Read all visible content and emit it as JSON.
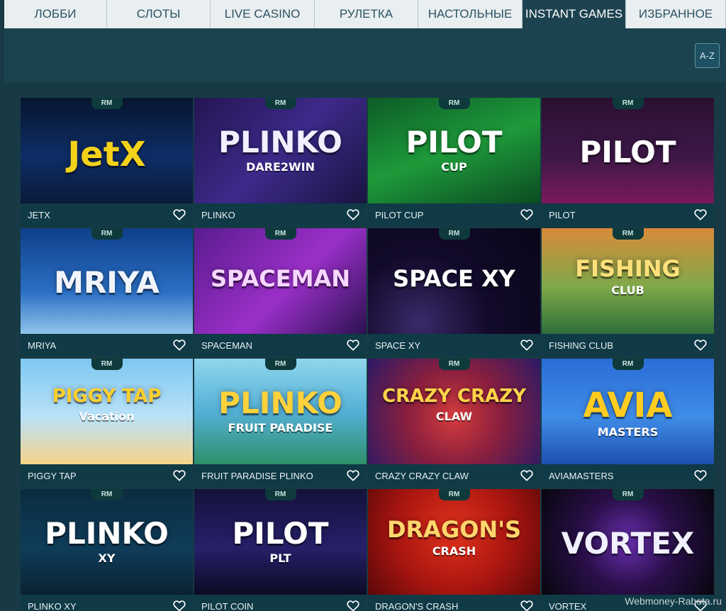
{
  "tabs": [
    {
      "label": "ЛОББИ",
      "width": 145,
      "active": false
    },
    {
      "label": "СЛОТЫ",
      "width": 146,
      "active": false
    },
    {
      "label": "LIVE CASINO",
      "width": 147,
      "active": false
    },
    {
      "label": "РУЛЕТКА",
      "width": 146,
      "active": false
    },
    {
      "label": "НАСТОЛЬНЫЕ",
      "width": 147,
      "active": false
    },
    {
      "label": "INSTANT GAMES",
      "width": 146,
      "active": true
    },
    {
      "label": "ИЗБРАННОЕ",
      "width": 141,
      "active": false
    }
  ],
  "sort_button": {
    "label": "A-Z"
  },
  "badge_label": "RM",
  "games": [
    {
      "title": "JETX",
      "art": "JetX",
      "bg": "linear-gradient(180deg,#07152f 0%,#0e2d66 55%,#0a1a3a 100%)",
      "art_color": "#f4d21a"
    },
    {
      "title": "PLINKO",
      "art": "PLINKO",
      "sub": "DARE2WIN",
      "bg": "linear-gradient(135deg,#241653 0%,#3d2a8a 50%,#1a1440 100%)",
      "art_color": "#f1f0ff"
    },
    {
      "title": "PILOT CUP",
      "art": "PILOT",
      "sub": "CUP",
      "bg": "linear-gradient(160deg,#0d5c27 0%,#1e9a3a 50%,#0b4a22 100%)",
      "art_color": "#ffffff"
    },
    {
      "title": "PILOT",
      "art": "PILOT",
      "bg": "linear-gradient(180deg,#2a1030 0%,#3d1848 55%,#7a1a5a 100%)",
      "art_color": "#ffffff"
    },
    {
      "title": "MRIYA",
      "art": "MRIYA",
      "bg": "linear-gradient(180deg,#0f3f8a 0%,#2a6fc4 60%,#8fc4ea 100%)",
      "art_color": "#f1f5fb"
    },
    {
      "title": "SPACEMAN",
      "art": "SPACEMAN",
      "bg": "linear-gradient(135deg,#5a1d8f 0%,#9b2fc9 55%,#2c1150 100%)",
      "art_color": "#f7d7ff"
    },
    {
      "title": "SPACE XY",
      "art": "SPACE XY",
      "bg": "radial-gradient(circle at 30% 90%,#3a2a6a 0%,#120a2a 45%,#0a0618 100%)",
      "art_color": "#ffffff"
    },
    {
      "title": "FISHING CLUB",
      "art": "FISHING",
      "sub": "CLUB",
      "bg": "linear-gradient(180deg,#d98a3a 0%,#7fa94a 55%,#2f6f3a 100%)",
      "art_color": "#ffe07a"
    },
    {
      "title": "PIGGY TAP",
      "art": "PIGGY TAP",
      "sub": "Vacation",
      "bg": "linear-gradient(180deg,#7ec7f0 0%,#b9e2f8 55%,#f7d48a 100%)",
      "art_color": "#ffcf2e"
    },
    {
      "title": "FRUIT PARADISE PLINKO",
      "art": "PLINKO",
      "sub": "FRUIT PARADISE",
      "bg": "linear-gradient(180deg,#8fd6ec 0%,#54b0d6 50%,#2e8f6b 100%)",
      "art_color": "#ffd13a"
    },
    {
      "title": "CRAZY CRAZY CLAW",
      "art": "CRAZY CRAZY",
      "sub": "CLAW",
      "bg": "radial-gradient(circle at 50% 55%,#d43c3c 0%,#8a1f3e 45%,#2b1a66 100%)",
      "art_color": "#ffd34a"
    },
    {
      "title": "AVIAMASTERS",
      "art": "AVIA",
      "sub": "MASTERS",
      "bg": "linear-gradient(180deg,#2b6cd6 0%,#3f8de8 55%,#1e4fb0 100%)",
      "art_color": "#ffcc1f"
    },
    {
      "title": "PLINKO XY",
      "art": "PLINKO",
      "sub": "XY",
      "bg": "linear-gradient(180deg,#0b2c40 0%,#0f3d5a 55%,#0a2232 100%)",
      "art_color": "#ffffff"
    },
    {
      "title": "PILOT COIN",
      "art": "PILOT",
      "sub": "PLT",
      "bg": "linear-gradient(180deg,#14123a 0%,#26206a 55%,#0c0b24 100%)",
      "art_color": "#ffffff"
    },
    {
      "title": "DRAGON'S CRASH",
      "art": "DRAGON'S",
      "sub": "CRASH",
      "bg": "radial-gradient(circle at 50% 40%,#e0321c 0%,#a81510 55%,#5a0808 100%)",
      "art_color": "#ffd66b"
    },
    {
      "title": "VORTEX",
      "art": "VORTEX",
      "bg": "radial-gradient(circle at 50% 50%,#6a2fb0 0%,#2a0f4a 45%,#07060d 100%)",
      "art_color": "#f0f0ff"
    }
  ],
  "watermark": "Webmoney-Rabota.ru"
}
